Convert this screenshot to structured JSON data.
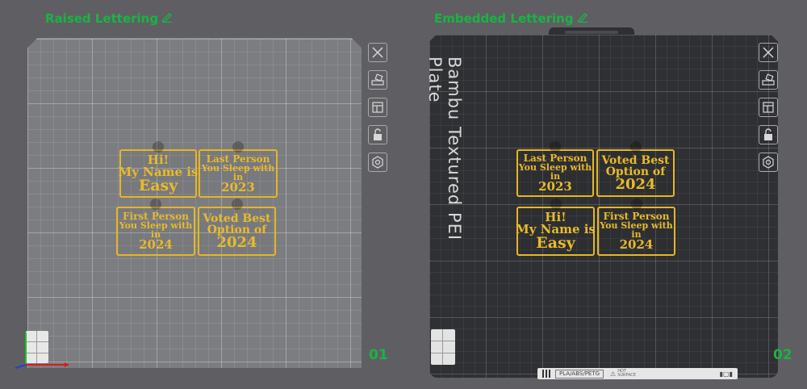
{
  "plates": [
    {
      "title": "Raised Lettering",
      "number": "01",
      "tags": [
        {
          "lines": [
            "Hi!",
            "My Name is",
            "Easy"
          ]
        },
        {
          "lines": [
            "Last Person",
            "You Sleep with",
            "in",
            "2023"
          ]
        },
        {
          "lines": [
            "First Person",
            "You Sleep with",
            "in",
            "2024"
          ]
        },
        {
          "lines": [
            "Voted Best",
            "Option of",
            "2024"
          ]
        }
      ]
    },
    {
      "title": "Embedded Lettering",
      "number": "02",
      "plate_label": "Bambu Textured PEI Plate",
      "tags": [
        {
          "lines": [
            "Last Person",
            "You Sleep with",
            "in",
            "2023"
          ]
        },
        {
          "lines": [
            "Voted Best",
            "Option of",
            "2024"
          ]
        },
        {
          "lines": [
            "Hi!",
            "My Name is",
            "Easy"
          ]
        },
        {
          "lines": [
            "First Person",
            "You Sleep with",
            "in",
            "2024"
          ]
        }
      ],
      "strip": {
        "material": "PLA/ABS/PETG",
        "hot_label_1": "HOT",
        "hot_label_2": "SURFACE"
      }
    }
  ],
  "toolbar_icons": [
    "close-icon",
    "arrange-icon",
    "orient-icon",
    "lock-icon",
    "settings-icon"
  ],
  "colors": {
    "title_green": "#19b443",
    "lettering_yellow": "#e4b726",
    "background": "#5f5f63",
    "light_bed": "#7c7d80",
    "dark_bed": "#2f3033"
  }
}
